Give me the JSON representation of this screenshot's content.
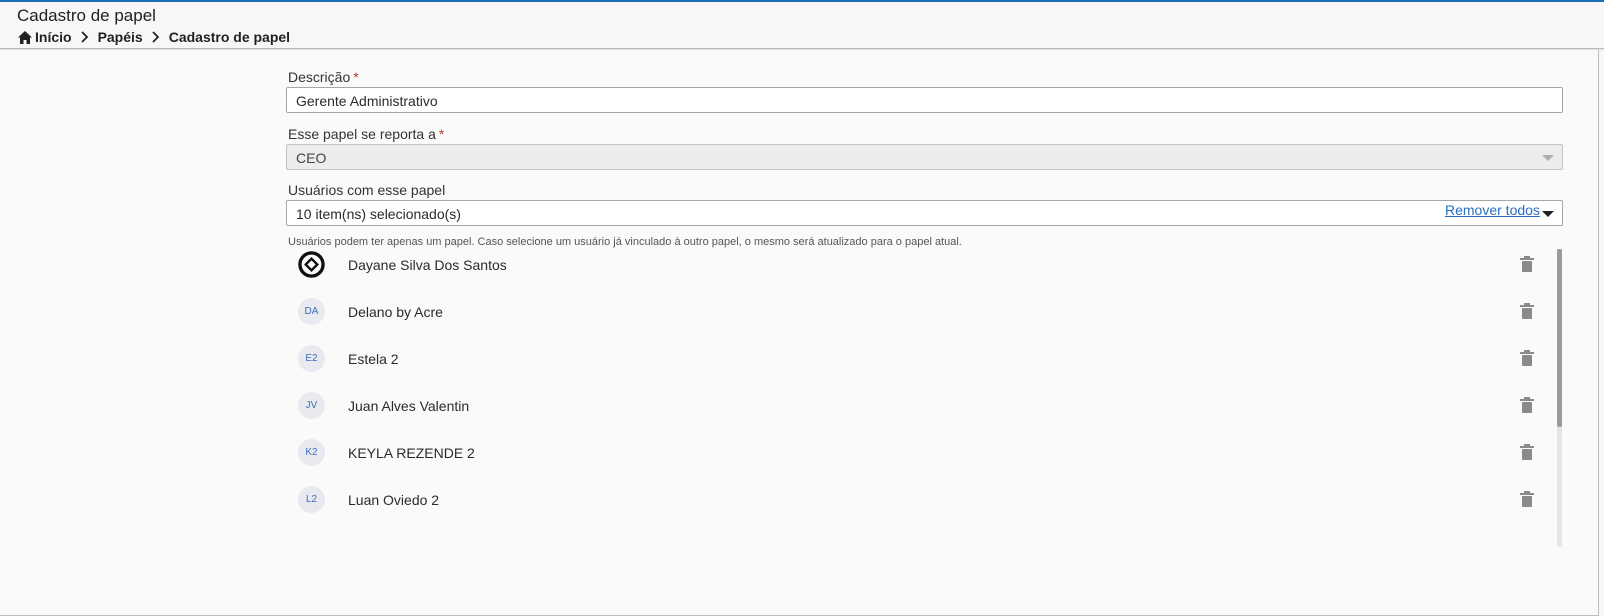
{
  "header": {
    "title": "Cadastro de papel",
    "breadcrumb": [
      "Início",
      "Papéis",
      "Cadastro de papel"
    ]
  },
  "form": {
    "descricao": {
      "label": "Descrição",
      "required": "*",
      "value": "Gerente Administrativo"
    },
    "reporta": {
      "label": "Esse papel se reporta a",
      "required": "*",
      "value": "CEO"
    },
    "usuarios": {
      "label": "Usuários com esse papel",
      "value": "10 item(ns) selecionado(s)",
      "help": "Usuários podem ter apenas um papel. Caso selecione um usuário já vinculado à outro papel, o mesmo será atualizado para o papel atual."
    }
  },
  "remove_all": "Remover todos",
  "users": [
    {
      "initials": "",
      "name": "Dayane Silva Dos Santos",
      "avatar_icon": "totvs-logo-icon"
    },
    {
      "initials": "DA",
      "name": "Delano by Acre"
    },
    {
      "initials": "E2",
      "name": "Estela 2"
    },
    {
      "initials": "JV",
      "name": "Juan Alves Valentin"
    },
    {
      "initials": "K2",
      "name": "KEYLA REZENDE 2"
    },
    {
      "initials": "L2",
      "name": "Luan Oviedo 2"
    }
  ],
  "colors": {
    "accent": "#1f6fb4",
    "link": "#2a6fbf",
    "required": "#c0392b"
  }
}
